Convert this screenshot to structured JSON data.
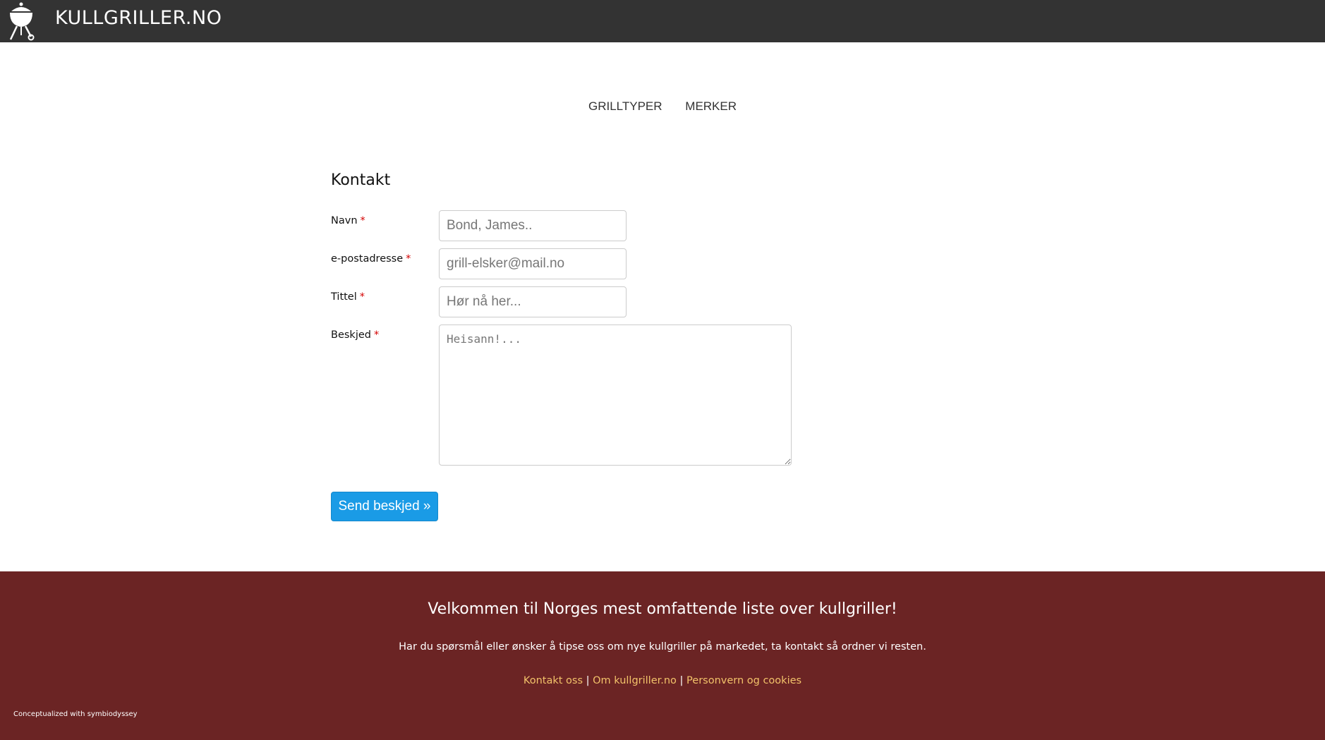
{
  "header": {
    "logo_icon": "kettle-grill-icon",
    "brand": "KULLGRILLER.NO"
  },
  "nav": {
    "items": [
      {
        "label": "GRILLTYPER"
      },
      {
        "label": "MERKER"
      }
    ]
  },
  "form": {
    "title": "Kontakt",
    "required_marker": "*",
    "name": {
      "label": "Navn",
      "placeholder": "Bond, James.."
    },
    "email": {
      "label": "e-postadresse",
      "placeholder": "grill-elsker@mail.no"
    },
    "subject": {
      "label": "Tittel",
      "placeholder": "Hør nå her..."
    },
    "message": {
      "label": "Beskjed",
      "placeholder": "Heisann!..."
    },
    "submit_label": "Send beskjed »"
  },
  "footer": {
    "title": "Velkommen til Norges mest omfattende liste over kullgriller!",
    "text": "Har du spørsmål eller ønsker å tipse oss om nye kullgriller på markedet, ta kontakt så ordner vi resten.",
    "links": [
      {
        "label": "Kontakt oss"
      },
      {
        "label": "Om kullgriller.no"
      },
      {
        "label": "Personvern og cookies"
      }
    ],
    "separator": "|",
    "credit": "Conceptualized with symbiodyssey"
  },
  "colors": {
    "topbar": "#333333",
    "footer_bg": "#6b2424",
    "footer_link": "#f2c26a",
    "button": "#1a9be6",
    "required": "#d40000"
  }
}
